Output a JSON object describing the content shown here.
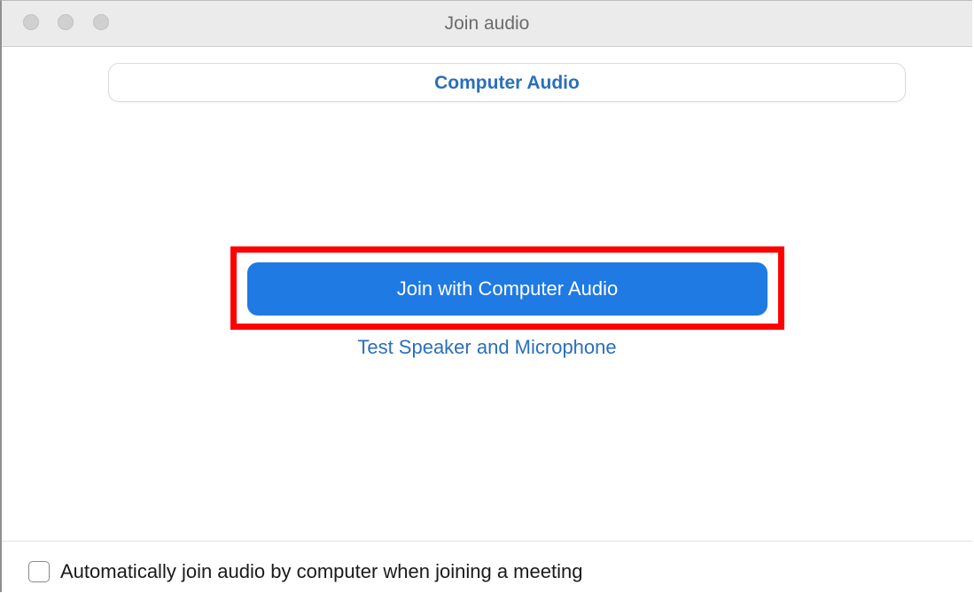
{
  "window": {
    "title": "Join audio"
  },
  "tabs": [
    {
      "label": "Computer Audio",
      "selected": true
    }
  ],
  "main": {
    "join_button_label": "Join with Computer Audio",
    "test_link_label": "Test Speaker and Microphone"
  },
  "footer": {
    "auto_join_label": "Automatically join audio by computer when joining a meeting",
    "auto_join_checked": false
  },
  "colors": {
    "accent": "#1f7ae3",
    "link": "#2a6fbb",
    "highlight": "#ff0000"
  },
  "icons": [
    "close-traffic-light",
    "minimize-traffic-light",
    "zoom-traffic-light",
    "checkbox-icon"
  ]
}
